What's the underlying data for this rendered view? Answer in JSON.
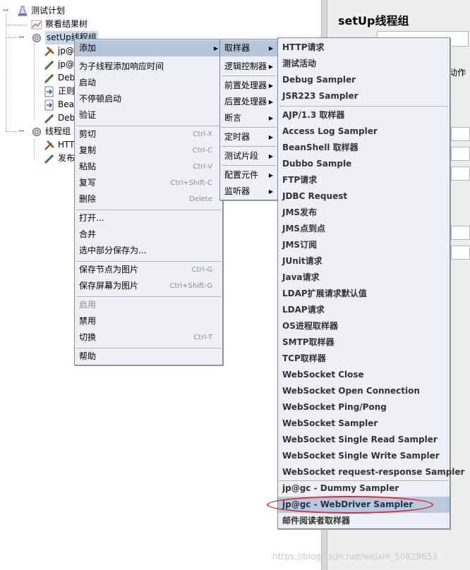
{
  "tree": {
    "root": "测试计划",
    "view_results": "察看结果树",
    "setup_group": "setUp线程组",
    "children_1": [
      "jp@",
      "jp@",
      "Deb",
      "正则",
      "Bea",
      "Deb"
    ],
    "thread_group": "线程组",
    "children_2": [
      "HTT",
      "发布"
    ]
  },
  "right_panel": {
    "title": "setUp线程组",
    "fragment": "动作"
  },
  "context_menu": {
    "items": [
      {
        "label": "添加",
        "shortcut": ""
      },
      {
        "label": "为子线程添加响应时间",
        "shortcut": ""
      },
      {
        "label": "启动",
        "shortcut": ""
      },
      {
        "label": "不停顿启动",
        "shortcut": ""
      },
      {
        "label": "验证",
        "shortcut": ""
      },
      {
        "label": "剪切",
        "shortcut": "Ctrl-X"
      },
      {
        "label": "复制",
        "shortcut": "Ctrl-C"
      },
      {
        "label": "粘贴",
        "shortcut": "Ctrl-V"
      },
      {
        "label": "复写",
        "shortcut": "Ctrl+Shift-C"
      },
      {
        "label": "删除",
        "shortcut": "Delete"
      },
      {
        "label": "打开...",
        "shortcut": ""
      },
      {
        "label": "合并",
        "shortcut": ""
      },
      {
        "label": "选中部分保存为...",
        "shortcut": ""
      },
      {
        "label": "保存节点为图片",
        "shortcut": "Ctrl-G"
      },
      {
        "label": "保存屏幕为图片",
        "shortcut": "Ctrl+Shift-G"
      },
      {
        "label": "启用",
        "shortcut": ""
      },
      {
        "label": "禁用",
        "shortcut": ""
      },
      {
        "label": "切换",
        "shortcut": "Ctrl-T"
      },
      {
        "label": "帮助",
        "shortcut": ""
      }
    ]
  },
  "add_submenu": {
    "items": [
      "取样器",
      "逻辑控制器",
      "前置处理器",
      "后置处理器",
      "断言",
      "定时器",
      "测试片段",
      "配置元件",
      "监听器"
    ]
  },
  "sampler_submenu": {
    "items": [
      "HTTP请求",
      "测试活动",
      "Debug Sampler",
      "JSR223 Sampler",
      "AJP/1.3 取样器",
      "Access Log Sampler",
      "BeanShell 取样器",
      "Dubbo Sample",
      "FTP请求",
      "JDBC Request",
      "JMS发布",
      "JMS点到点",
      "JMS订阅",
      "JUnit请求",
      "Java请求",
      "LDAP扩展请求默认值",
      "LDAP请求",
      "OS进程取样器",
      "SMTP取样器",
      "TCP取样器",
      "WebSocket Close",
      "WebSocket Open Connection",
      "WebSocket Ping/Pong",
      "WebSocket Sampler",
      "WebSocket Single Read Sampler",
      "WebSocket Single Write Sampler",
      "WebSocket request-response Sampler",
      "jp@gc - Dummy Sampler",
      "jp@gc - WebDriver Sampler",
      "邮件阅读者取样器"
    ]
  },
  "watermark": "https://blog.csdn.net/weixin_50829653",
  "colors": {
    "menu_bg": "#eef0f5",
    "highlight": "#b6c6da",
    "annotation": "#e2262a"
  }
}
